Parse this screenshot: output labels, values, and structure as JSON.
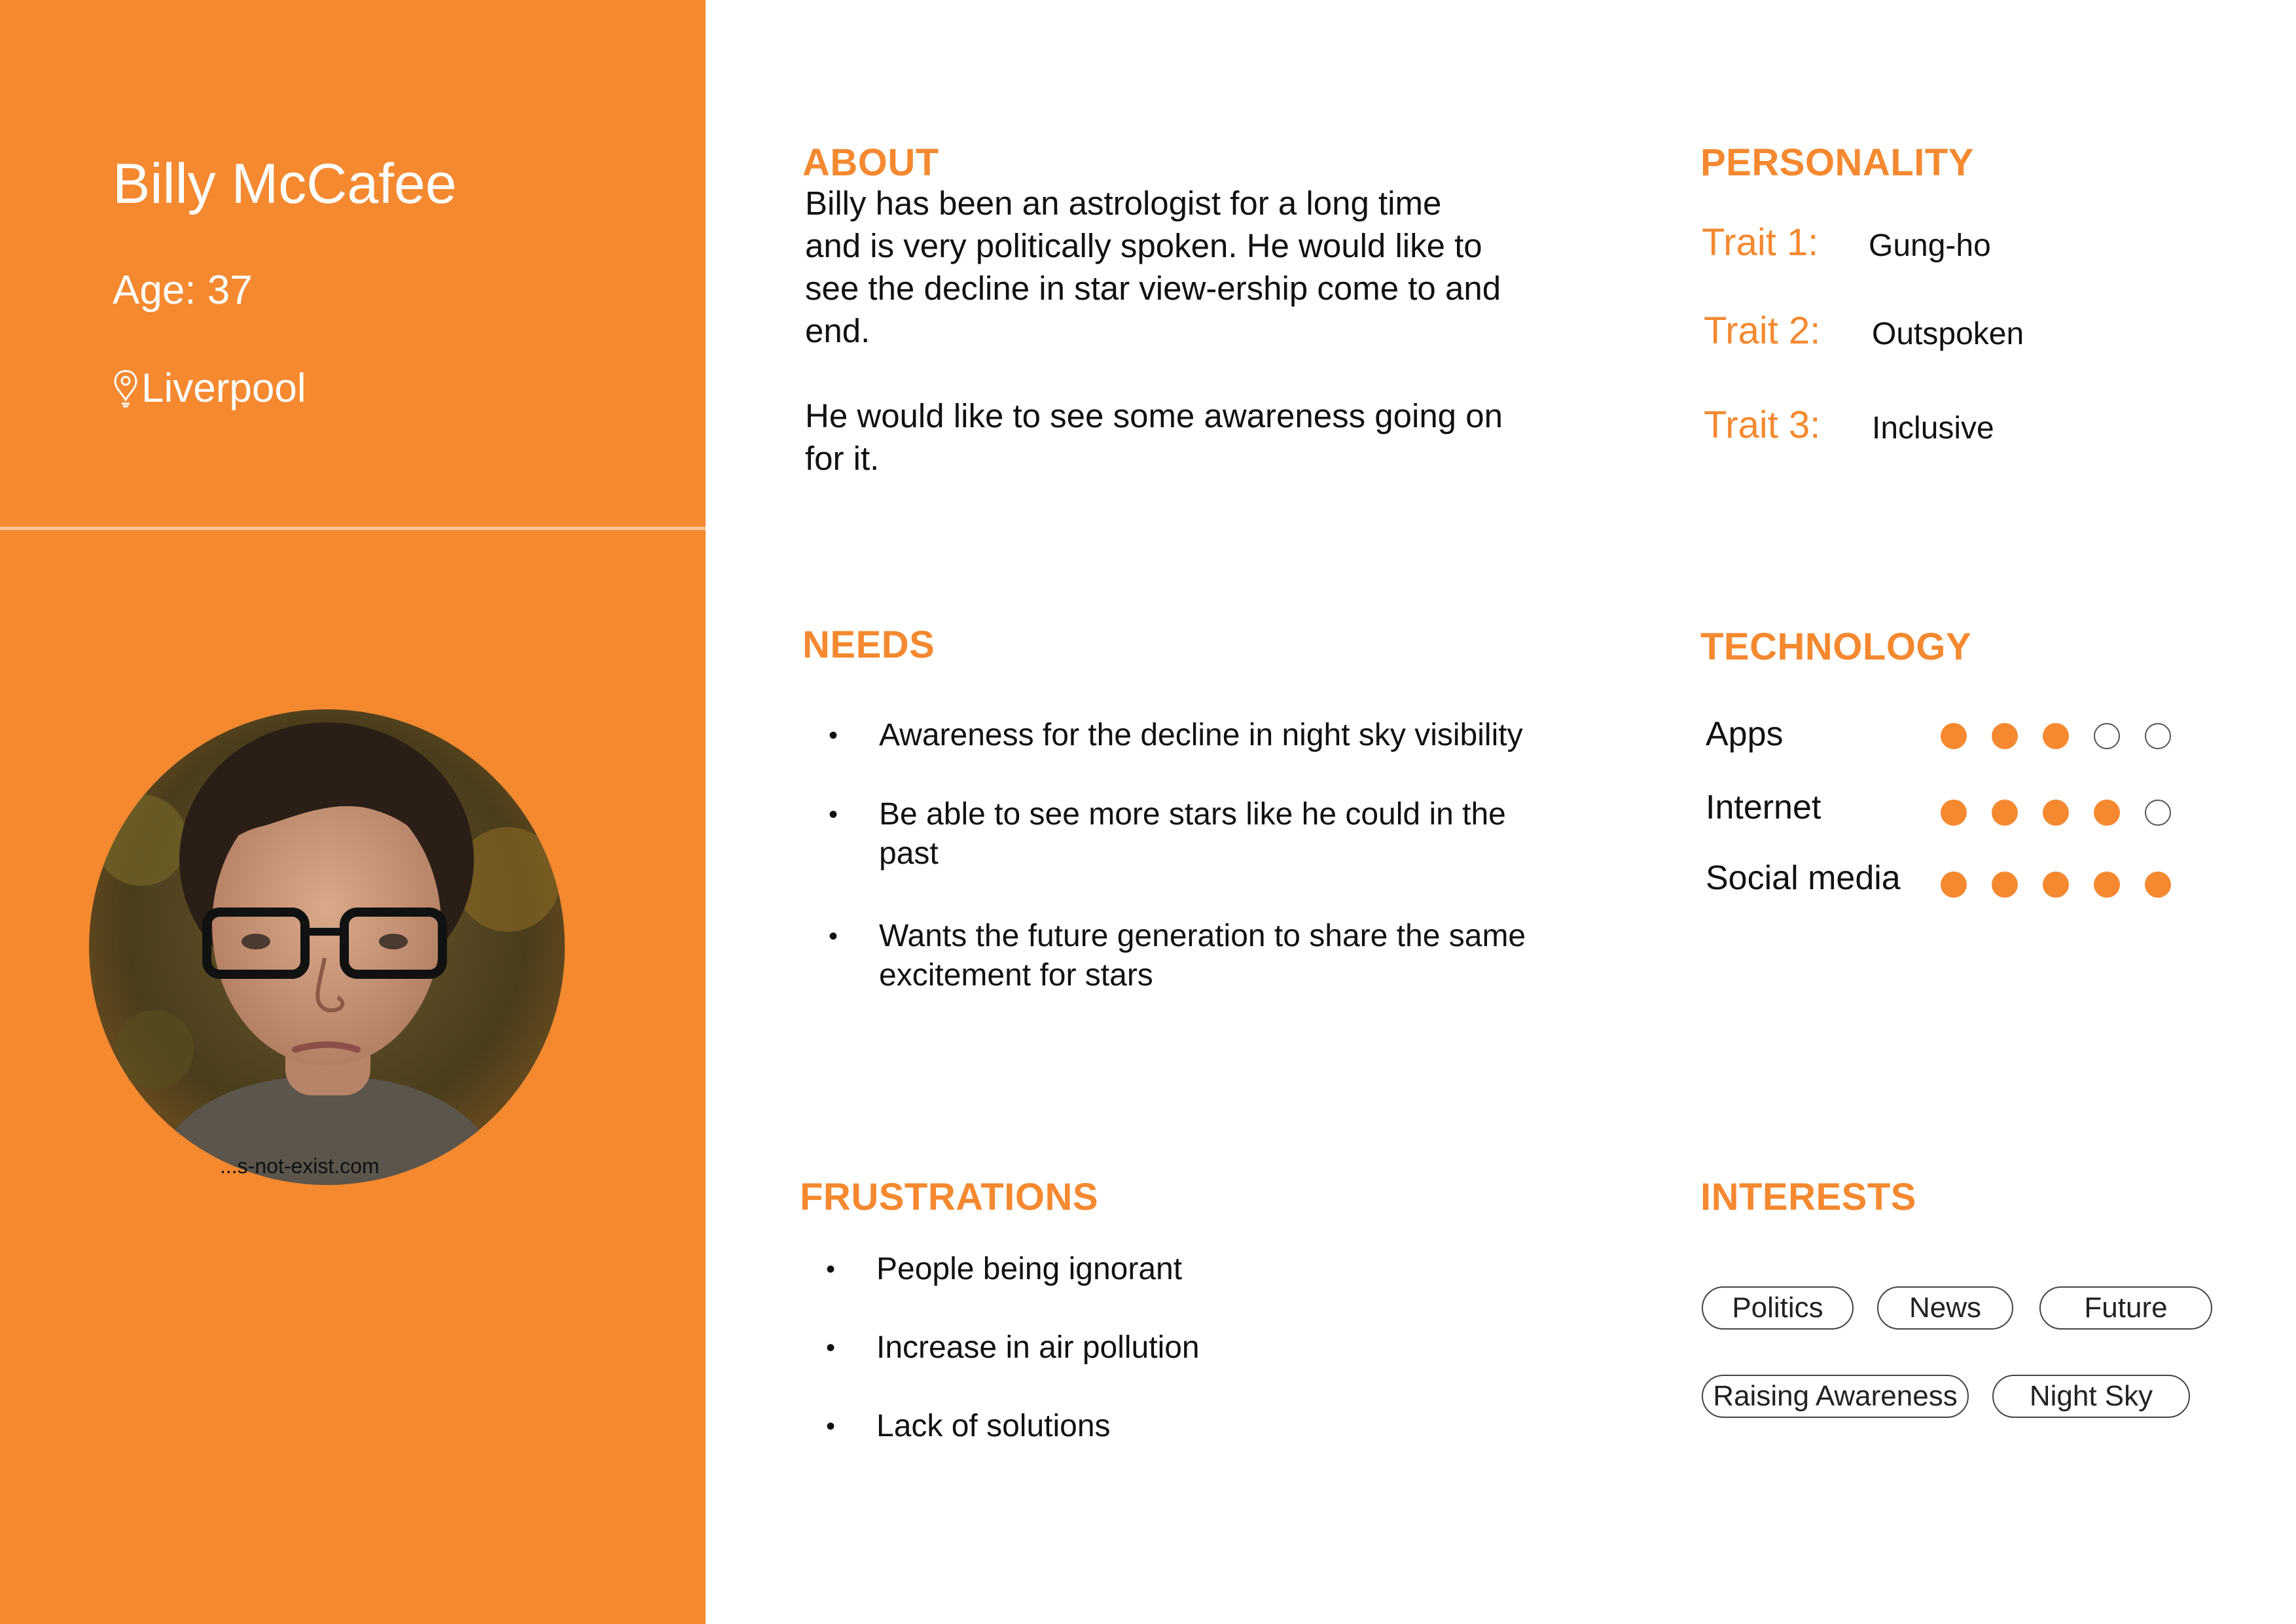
{
  "persona": {
    "name": "Billy McCafee",
    "age": "Age: 37",
    "location": "Liverpool",
    "photo_watermark": "...s-not-exist.com"
  },
  "about": {
    "title": "ABOUT",
    "paragraphs": [
      "Billy has been an astrologist for a long time and is very politically spoken. He would like to see the decline in star view-ership come to and end.",
      "He would like to see some awareness going on for it."
    ]
  },
  "needs": {
    "title": "NEEDS",
    "items": [
      "Awareness for the decline in night sky visibility",
      "Be able to see more stars like he could in the past",
      "Wants the future generation to share the same excitement for stars"
    ]
  },
  "frustrations": {
    "title": "FRUSTRATIONS",
    "items": [
      "People being ignorant",
      "Increase in air pollution",
      "Lack of solutions"
    ]
  },
  "personality": {
    "title": "PERSONALITY",
    "traits": [
      {
        "label": "Trait 1:",
        "value": "Gung-ho"
      },
      {
        "label": "Trait 2:",
        "value": "Outspoken"
      },
      {
        "label": "Trait 3:",
        "value": "Inclusive"
      }
    ]
  },
  "technology": {
    "title": "TECHNOLOGY",
    "scale_max": 5,
    "items": [
      {
        "label": "Apps",
        "rating": 3
      },
      {
        "label": "Internet",
        "rating": 4
      },
      {
        "label": "Social media",
        "rating": 5
      }
    ]
  },
  "interests": {
    "title": "INTERESTS",
    "tags": [
      "Politics",
      "News",
      "Future",
      "Raising Awareness",
      "Night Sky"
    ]
  },
  "colors": {
    "accent": "#F48930",
    "divider": "#F9C49A",
    "text": "#111111"
  },
  "icons": {
    "location": "map-pin-icon"
  }
}
